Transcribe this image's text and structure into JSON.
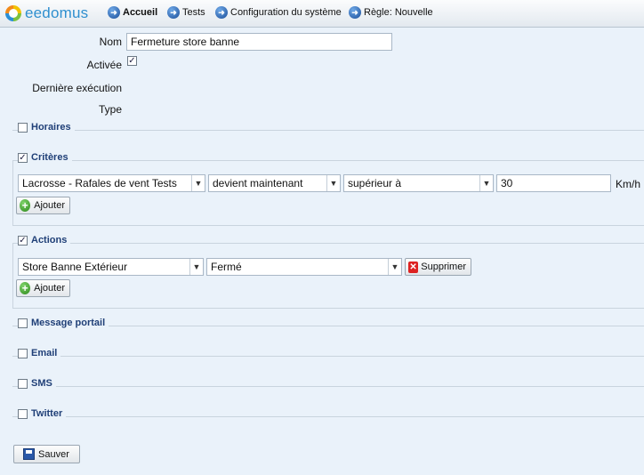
{
  "app": {
    "logo_text": "eedomus"
  },
  "nav": [
    {
      "label": "Accueil",
      "bold": true
    },
    {
      "label": "Tests",
      "bold": false
    },
    {
      "label": "Configuration du système",
      "bold": false
    },
    {
      "label": "Règle: Nouvelle",
      "bold": false
    }
  ],
  "form": {
    "nom_label": "Nom",
    "nom_value": "Fermeture store banne",
    "activee_label": "Activée",
    "activee_checked": true,
    "derniere_label": "Dernière exécution",
    "type_label": "Type"
  },
  "sections": {
    "horaires": {
      "title": "Horaires",
      "checked": false
    },
    "criteres": {
      "title": "Critères",
      "checked": true,
      "row": {
        "device": "Lacrosse - Rafales de vent Tests",
        "condition": "devient maintenant",
        "comparator": "supérieur à",
        "value": "30",
        "unit": "Km/h"
      },
      "add_label": "Ajouter"
    },
    "actions": {
      "title": "Actions",
      "checked": true,
      "row": {
        "device": "Store Banne Extérieur",
        "state": "Fermé",
        "delete_label": "Supprimer"
      },
      "add_label": "Ajouter"
    },
    "message_portail": {
      "title": "Message portail",
      "checked": false
    },
    "email": {
      "title": "Email",
      "checked": false
    },
    "sms": {
      "title": "SMS",
      "checked": false
    },
    "twitter": {
      "title": "Twitter",
      "checked": false
    }
  },
  "save_label": "Sauver",
  "icons": {
    "nav": "arrow-right-circle-icon",
    "add": "plus-circle-icon",
    "delete": "red-x-icon",
    "save": "floppy-disk-icon",
    "dropdown": "chevron-down-icon"
  },
  "colors": {
    "background": "#eaf2fa",
    "section_title": "#1f3f77",
    "logo": "#2f8fcf"
  }
}
